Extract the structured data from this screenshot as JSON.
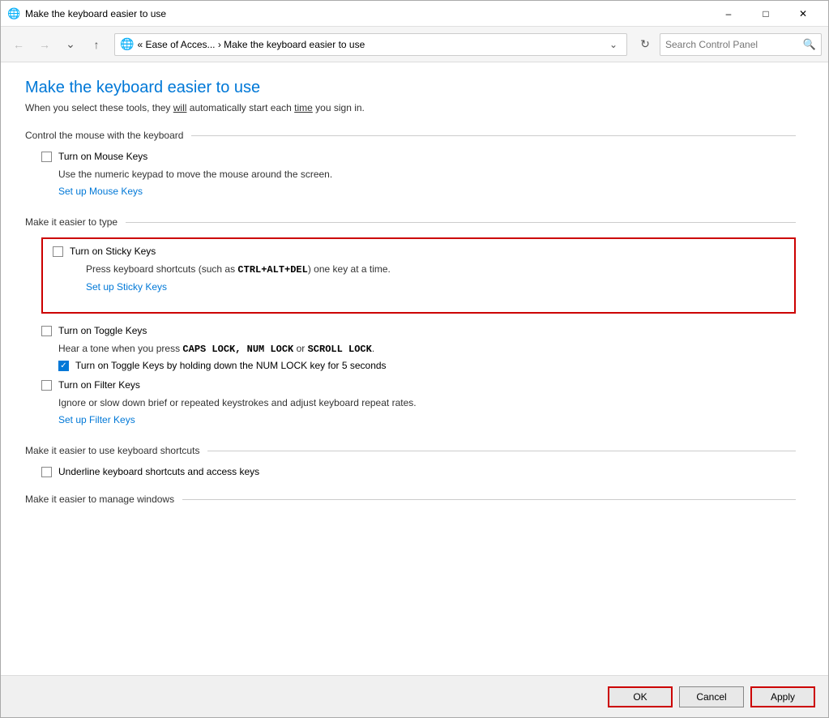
{
  "window": {
    "title": "Make the keyboard easier to use",
    "icon": "🌐"
  },
  "titlebar": {
    "minimize": "–",
    "maximize": "□",
    "close": "✕"
  },
  "navbar": {
    "back_label": "←",
    "forward_label": "→",
    "dropdown_label": "˅",
    "up_label": "↑",
    "address_icon": "🌐",
    "address_text": "« Ease of Acces... › Make the keyboard easier to use",
    "dropdown_arrow": "˅",
    "refresh_label": "↻",
    "search_placeholder": "Search Control Panel",
    "search_icon": "🔍"
  },
  "page": {
    "title": "Make the keyboard easier to use",
    "subtitle_text": "When you select these tools, they will automatically start each time you sign in."
  },
  "sections": {
    "mouse_section": {
      "title": "Control the mouse with the keyboard",
      "mouse_keys_label": "Turn on Mouse Keys",
      "mouse_keys_checked": false,
      "mouse_keys_desc": "Use the numeric keypad to move the mouse around the screen.",
      "mouse_keys_link": "Set up Mouse Keys"
    },
    "type_section": {
      "title": "Make it easier to type",
      "sticky_keys_label": "Turn on Sticky Keys",
      "sticky_keys_checked": false,
      "sticky_keys_desc_prefix": "Press keyboard shortcuts (such as ",
      "sticky_keys_shortcut": "CTRL+ALT+DEL",
      "sticky_keys_desc_suffix": ") one key at a time.",
      "sticky_keys_link": "Set up Sticky Keys",
      "toggle_keys_label": "Turn on Toggle Keys",
      "toggle_keys_checked": false,
      "toggle_keys_desc_prefix": "Hear a tone when you press ",
      "toggle_keys_keys": "CAPS LOCK, NUM LOCK",
      "toggle_keys_desc_middle": " or ",
      "toggle_keys_keys2": "SCROLL LOCK",
      "toggle_keys_desc_suffix": ".",
      "toggle_subopt_label": "Turn on Toggle Keys by holding down the ",
      "toggle_subopt_key": "NUM LOCK",
      "toggle_subopt_suffix": " key for 5 seconds",
      "toggle_subopt_checked": true,
      "filter_keys_label": "Turn on Filter Keys",
      "filter_keys_checked": false,
      "filter_keys_desc": "Ignore or slow down brief or repeated keystrokes and adjust keyboard repeat rates.",
      "filter_keys_link": "Set up Filter Keys"
    },
    "shortcuts_section": {
      "title": "Make it easier to use keyboard shortcuts",
      "underline_label": "Underline keyboard shortcuts and access keys",
      "underline_checked": false
    },
    "windows_section": {
      "title": "Make it easier to manage windows"
    }
  },
  "footer": {
    "ok_label": "OK",
    "cancel_label": "Cancel",
    "apply_label": "Apply"
  }
}
